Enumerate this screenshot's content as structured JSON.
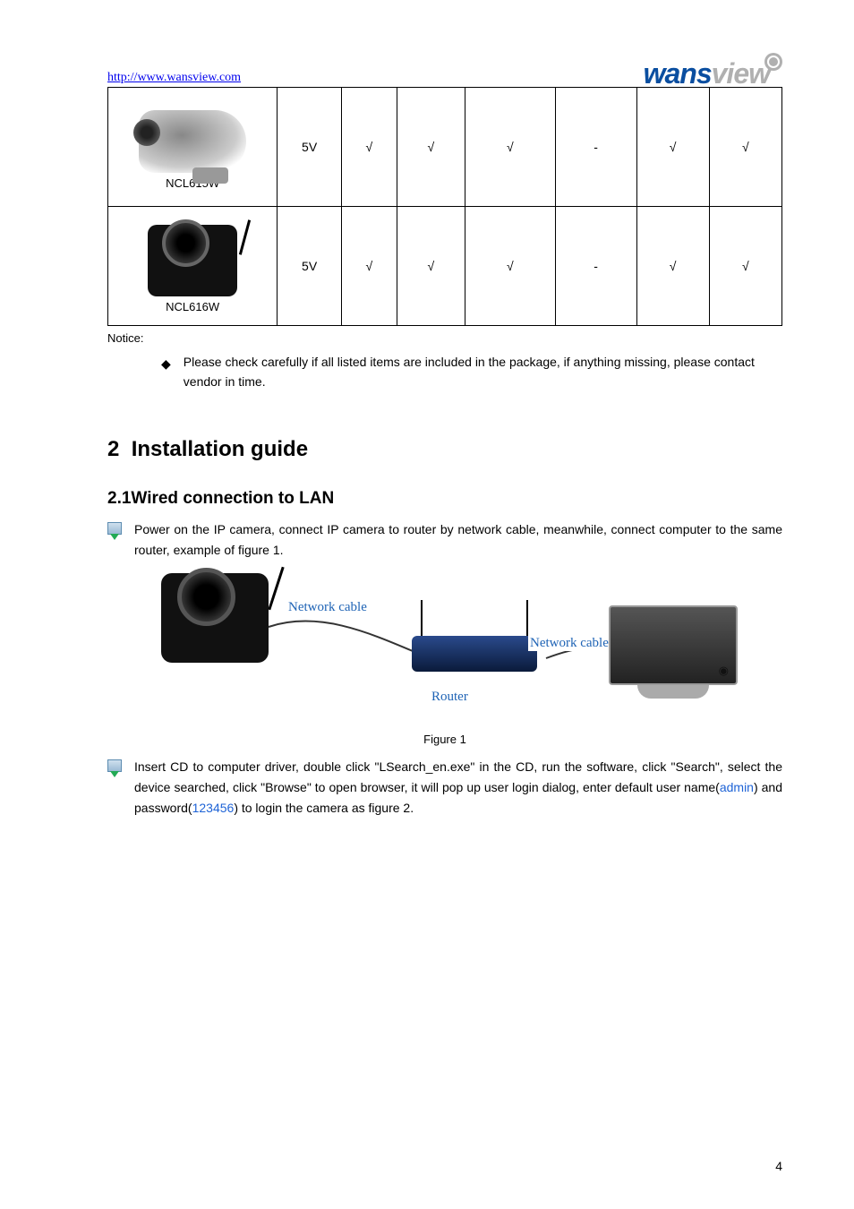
{
  "header": {
    "url": "http://www.wansview.com",
    "logo_primary": "wans",
    "logo_secondary": "view"
  },
  "table": {
    "rows": [
      {
        "model": "NCL615W",
        "cells": [
          "5V",
          "√",
          "√",
          "√",
          "-",
          "√",
          "√"
        ],
        "imgClass": "bullet"
      },
      {
        "model": "NCL616W",
        "cells": [
          "5V",
          "√",
          "√",
          "√",
          "-",
          "√",
          "√"
        ],
        "imgClass": "ptz"
      }
    ]
  },
  "notice": {
    "label": "Notice:",
    "item": "Please check carefully if all listed items are included in the package, if anything missing, please contact vendor in time."
  },
  "section": {
    "num": "2",
    "title": "Installation guide"
  },
  "subsection": {
    "num": "2.1",
    "title": "Wired connection to LAN"
  },
  "para1": "Power on the IP camera, connect IP camera to router by network cable, meanwhile, connect computer to the same router, example of figure 1.",
  "diagram": {
    "cable1": "Network cable",
    "cable2": "Network cable",
    "router": "Router"
  },
  "figcap": "Figure 1",
  "para2_pre": "Insert CD to computer driver, double click \"LSearch_en.exe\" in the CD, run the software, click \"Search\", select the device searched, click \"Browse\" to open browser, it will pop up user login dialog, enter default user name(",
  "para2_admin": "admin",
  "para2_mid": ") and password(",
  "para2_pw": "123456",
  "para2_post": ") to login the camera as figure 2.",
  "page_number": "4"
}
